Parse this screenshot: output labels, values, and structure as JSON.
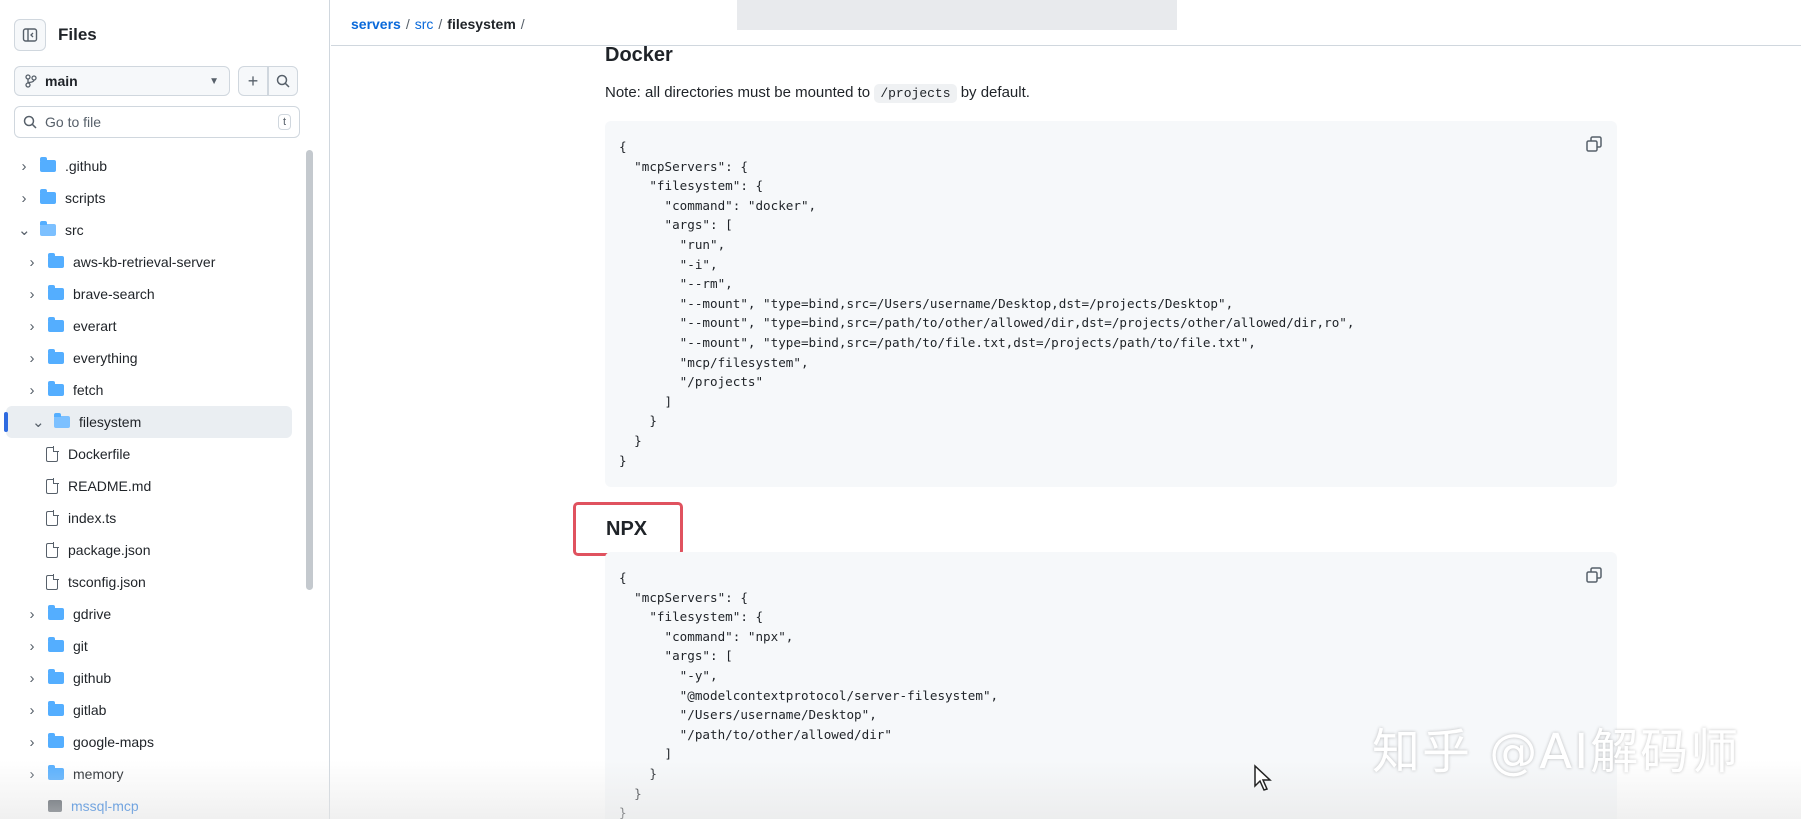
{
  "sidebar": {
    "title": "Files",
    "branch": "main",
    "search_placeholder": "Go to file",
    "search_shortcut": "t",
    "items": [
      {
        "label": ".github",
        "kind": "folder",
        "depth": 0,
        "expanded": false
      },
      {
        "label": "scripts",
        "kind": "folder",
        "depth": 0,
        "expanded": false
      },
      {
        "label": "src",
        "kind": "folder",
        "depth": 0,
        "expanded": true
      },
      {
        "label": "aws-kb-retrieval-server",
        "kind": "folder",
        "depth": 1,
        "expanded": false
      },
      {
        "label": "brave-search",
        "kind": "folder",
        "depth": 1,
        "expanded": false
      },
      {
        "label": "everart",
        "kind": "folder",
        "depth": 1,
        "expanded": false
      },
      {
        "label": "everything",
        "kind": "folder",
        "depth": 1,
        "expanded": false
      },
      {
        "label": "fetch",
        "kind": "folder",
        "depth": 1,
        "expanded": false
      },
      {
        "label": "filesystem",
        "kind": "folder",
        "depth": 1,
        "expanded": true,
        "active": true
      },
      {
        "label": "Dockerfile",
        "kind": "file",
        "depth": 2
      },
      {
        "label": "README.md",
        "kind": "file",
        "depth": 2
      },
      {
        "label": "index.ts",
        "kind": "file",
        "depth": 2
      },
      {
        "label": "package.json",
        "kind": "file",
        "depth": 2
      },
      {
        "label": "tsconfig.json",
        "kind": "file",
        "depth": 2
      },
      {
        "label": "gdrive",
        "kind": "folder",
        "depth": 1,
        "expanded": false
      },
      {
        "label": "git",
        "kind": "folder",
        "depth": 1,
        "expanded": false
      },
      {
        "label": "github",
        "kind": "folder",
        "depth": 1,
        "expanded": false
      },
      {
        "label": "gitlab",
        "kind": "folder",
        "depth": 1,
        "expanded": false
      },
      {
        "label": "google-maps",
        "kind": "folder",
        "depth": 1,
        "expanded": false
      },
      {
        "label": "memory",
        "kind": "folder",
        "depth": 1,
        "expanded": false
      },
      {
        "label": "mssql-mcp",
        "kind": "submodule",
        "depth": 1
      }
    ]
  },
  "breadcrumb": {
    "root": "servers",
    "mid": "src",
    "current": "filesystem",
    "sep": "/"
  },
  "main": {
    "docker_heading": "Docker",
    "note_prefix": "Note: all directories must be mounted to",
    "note_code": "/projects",
    "note_suffix": "by default.",
    "docker_code": "{\n  \"mcpServers\": {\n    \"filesystem\": {\n      \"command\": \"docker\",\n      \"args\": [\n        \"run\",\n        \"-i\",\n        \"--rm\",\n        \"--mount\", \"type=bind,src=/Users/username/Desktop,dst=/projects/Desktop\",\n        \"--mount\", \"type=bind,src=/path/to/other/allowed/dir,dst=/projects/other/allowed/dir,ro\",\n        \"--mount\", \"type=bind,src=/path/to/file.txt,dst=/projects/path/to/file.txt\",\n        \"mcp/filesystem\",\n        \"/projects\"\n      ]\n    }\n  }\n}",
    "npx_heading": "NPX",
    "npx_code": "{\n  \"mcpServers\": {\n    \"filesystem\": {\n      \"command\": \"npx\",\n      \"args\": [\n        \"-y\",\n        \"@modelcontextprotocol/server-filesystem\",\n        \"/Users/username/Desktop\",\n        \"/path/to/other/allowed/dir\"\n      ]\n    }\n  }\n}"
  },
  "watermark": "知乎 @AI解码师",
  "colors": {
    "accent": "#0969da",
    "highlight_box": "#e0525f",
    "folder": "#54aeff"
  }
}
